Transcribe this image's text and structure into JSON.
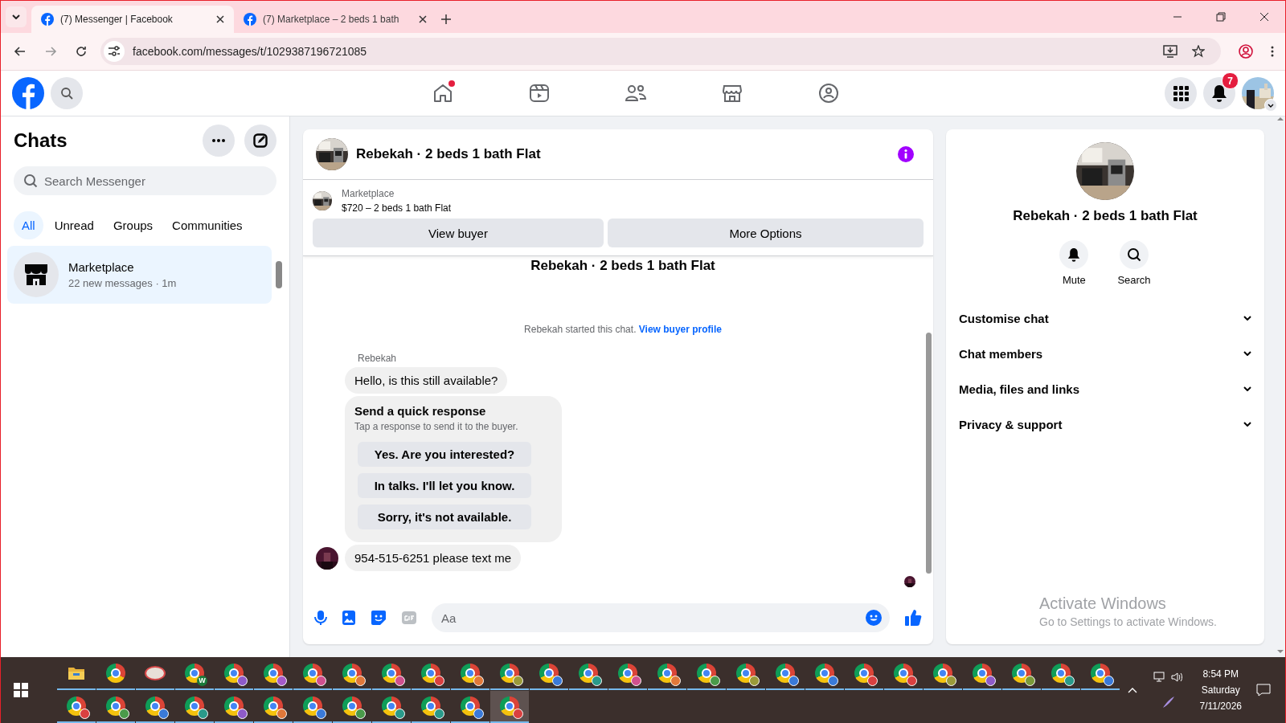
{
  "browser": {
    "tabs": [
      {
        "title": "(7) Messenger | Facebook",
        "selected": true
      },
      {
        "title": "(7) Marketplace – 2 beds 1 bath",
        "selected": false
      }
    ],
    "url": "facebook.com/messages/t/1029387196721085"
  },
  "topnav": [
    {
      "kind": "home",
      "dot": true
    },
    {
      "kind": "video",
      "dot": false
    },
    {
      "kind": "friends",
      "dot": false
    },
    {
      "kind": "marketplace",
      "dot": false
    },
    {
      "kind": "groups",
      "dot": false
    }
  ],
  "notifications": {
    "badge": "7"
  },
  "sidebar": {
    "title": "Chats",
    "search": {
      "placeholder": "Search Messenger"
    },
    "filters": [
      {
        "label": "All",
        "selected": true
      },
      {
        "label": "Unread",
        "selected": false
      },
      {
        "label": "Groups",
        "selected": false
      },
      {
        "label": "Communities",
        "selected": false
      }
    ],
    "chats": [
      {
        "name": "Marketplace",
        "preview": "22 new messages · 1m",
        "selected": true
      }
    ]
  },
  "chat": {
    "title": "Rebekah · 2 beds 1 bath Flat",
    "listing": {
      "source": "Marketplace",
      "title": "$720 – 2 beds 1 bath Flat"
    },
    "actions": [
      "View buyer",
      "More Options"
    ],
    "thread_title": "Rebekah · 2 beds 1 bath Flat",
    "started": {
      "text": "Rebekah started this chat.",
      "link": "View buyer profile"
    },
    "sender": "Rebekah",
    "first_message": "Hello, is this still available?",
    "quick_response": {
      "title": "Send a quick response",
      "subtitle": "Tap a response to send it to the buyer.",
      "options": [
        "Yes. Are you interested?",
        "In talks. I'll let you know.",
        "Sorry, it's not available."
      ]
    },
    "last_message": "954-515-6251 please text me",
    "composer": {
      "placeholder": "Aa"
    }
  },
  "details": {
    "title": "Rebekah · 2 beds 1 bath Flat",
    "actions": [
      {
        "kind": "mute",
        "label": "Mute"
      },
      {
        "kind": "search",
        "label": "Search"
      }
    ],
    "sections": [
      {
        "label": "Customise chat",
        "expanded": false
      },
      {
        "label": "Chat members",
        "expanded": false
      },
      {
        "label": "Media, files and links",
        "expanded": false
      },
      {
        "label": "Privacy & support",
        "expanded": false
      }
    ]
  },
  "activation": {
    "title": "Activate Windows",
    "subtitle": "Go to Settings to activate Windows."
  },
  "taskbar": {
    "apps": [
      {
        "kind": "explorer",
        "selected": false
      },
      {
        "kind": "chrome",
        "selected": false
      },
      {
        "kind": "paint",
        "selected": false
      },
      {
        "kind": "chrome-letter",
        "badge": "W",
        "selected": false
      },
      {
        "kind": "chrome-profile",
        "color": "#8e5bc9",
        "selected": false
      },
      {
        "kind": "chrome-profile",
        "color": "#a55bc9",
        "selected": false
      },
      {
        "kind": "chrome-profile",
        "color": "#d0508e",
        "selected": false
      },
      {
        "kind": "chrome-profile",
        "color": "#e0783a",
        "selected": false
      },
      {
        "kind": "chrome-profile",
        "color": "#d0508e",
        "selected": false
      },
      {
        "kind": "chrome-profile",
        "color": "#d94040",
        "selected": false
      },
      {
        "kind": "chrome-profile",
        "color": "#e0783a",
        "selected": false
      },
      {
        "kind": "chrome-profile",
        "color": "#9a9a3a",
        "selected": false
      },
      {
        "kind": "chrome-profile",
        "color": "#3a7ad9",
        "selected": false
      },
      {
        "kind": "chrome-profile",
        "color": "#2a9a8a",
        "selected": false
      },
      {
        "kind": "chrome-profile",
        "color": "#d0508e",
        "selected": false
      },
      {
        "kind": "chrome-profile",
        "color": "#e0783a",
        "selected": false
      },
      {
        "kind": "chrome-profile",
        "color": "#4a9a4a",
        "selected": false
      },
      {
        "kind": "chrome-profile",
        "color": "#9a9a3a",
        "selected": false
      },
      {
        "kind": "chrome-profile",
        "color": "#3a7ad9",
        "selected": false
      },
      {
        "kind": "chrome-profile",
        "color": "#3a7ad9",
        "selected": false
      },
      {
        "kind": "chrome-profile",
        "color": "#d94040",
        "selected": false
      },
      {
        "kind": "chrome-profile",
        "color": "#d94040",
        "selected": false
      },
      {
        "kind": "chrome-profile",
        "color": "#9a9a3a",
        "selected": false
      },
      {
        "kind": "chrome-profile",
        "color": "#8e5bc9",
        "selected": false
      },
      {
        "kind": "chrome-profile",
        "color": "#7a9a3a",
        "selected": false
      },
      {
        "kind": "chrome-profile",
        "color": "#2a9a8a",
        "selected": false
      },
      {
        "kind": "chrome-profile",
        "color": "#3a7ad9",
        "selected": false
      },
      {
        "kind": "chrome-profile",
        "color": "#d94040",
        "selected": false
      },
      {
        "kind": "chrome-profile",
        "color": "#4a9a4a",
        "selected": false
      },
      {
        "kind": "chrome-profile",
        "color": "#3a7ad9",
        "selected": false
      },
      {
        "kind": "chrome-profile",
        "color": "#2a9a8a",
        "selected": false
      },
      {
        "kind": "chrome-profile",
        "color": "#8e5bc9",
        "selected": false
      },
      {
        "kind": "chrome-profile",
        "color": "#e0783a",
        "selected": false
      },
      {
        "kind": "chrome-profile",
        "color": "#3a7ad9",
        "selected": false
      },
      {
        "kind": "chrome-profile",
        "color": "#4a9a4a",
        "selected": false
      },
      {
        "kind": "chrome-profile",
        "color": "#2a9a8a",
        "selected": false
      },
      {
        "kind": "chrome-profile",
        "color": "#2a9a8a",
        "selected": false
      },
      {
        "kind": "chrome-profile",
        "color": "#3a7ad9",
        "selected": false
      },
      {
        "kind": "chrome-profile",
        "color": "#d94040",
        "selected": true
      }
    ],
    "clock": {
      "time": "8:54 PM",
      "day": "Saturday",
      "date": "7/11/2026"
    }
  }
}
